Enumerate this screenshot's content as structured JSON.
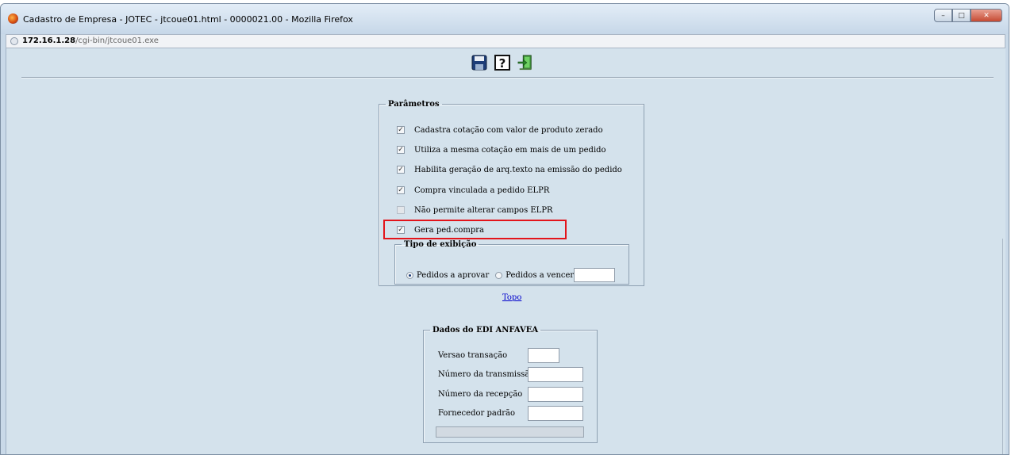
{
  "window": {
    "title": "Cadastro de Empresa - JOTEC - jtcoue01.html - 0000021.00 - Mozilla Firefox",
    "url_host": "172.16.1.28",
    "url_path": "/cgi-bin/jtcoue01.exe"
  },
  "toolbar": {
    "icons": [
      "save-icon",
      "help-icon",
      "exit-icon"
    ]
  },
  "parametros": {
    "legend": "Parâmetros",
    "items": [
      {
        "label": "Cadastra cotação com valor de produto zerado",
        "checked": true
      },
      {
        "label": "Utiliza a mesma cotação em mais de um pedido",
        "checked": true
      },
      {
        "label": "Habilita geração de arq.texto na emissão do pedido",
        "checked": true
      },
      {
        "label": "Compra vinculada a pedido ELPR",
        "checked": true
      },
      {
        "label": "Não permite alterar campos ELPR",
        "checked": false
      },
      {
        "label": "Gera ped.compra",
        "checked": true
      }
    ],
    "tipo": {
      "legend": "Tipo de exibição",
      "option1": "Pedidos a aprovar",
      "option2": "Pedidos a vencer",
      "option2_value": ""
    }
  },
  "links": {
    "topo": "Topo"
  },
  "edi": {
    "legend": "Dados do EDI ANFAVEA",
    "fields": [
      {
        "label": "Versao transação",
        "value": ""
      },
      {
        "label": "Número da transmissão",
        "value": ""
      },
      {
        "label": "Número da recepção",
        "value": ""
      },
      {
        "label": "Fornecedor padrão",
        "value": ""
      }
    ]
  },
  "colors": {
    "highlight": "#e3141b",
    "background": "#d4e2ec"
  }
}
